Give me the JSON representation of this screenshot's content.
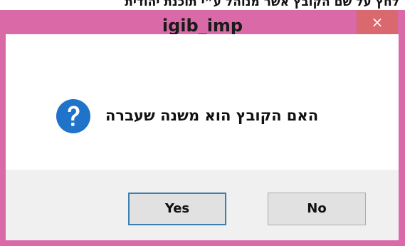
{
  "background_text": "לחץ על שם הקובץ אשר מנוהל ע״י תוכנת יהודית",
  "window": {
    "title": "igib_imp",
    "close_glyph": "×"
  },
  "dialog": {
    "icon": "question-icon",
    "message": "האם הקובץ הוא משנה שעברה",
    "buttons": {
      "yes": "Yes",
      "no": "No"
    }
  },
  "colors": {
    "frame": "#d96aa7",
    "close_button": "#d9686f",
    "icon_blue": "#1f73c9",
    "default_button_border": "#3c7fb1"
  }
}
